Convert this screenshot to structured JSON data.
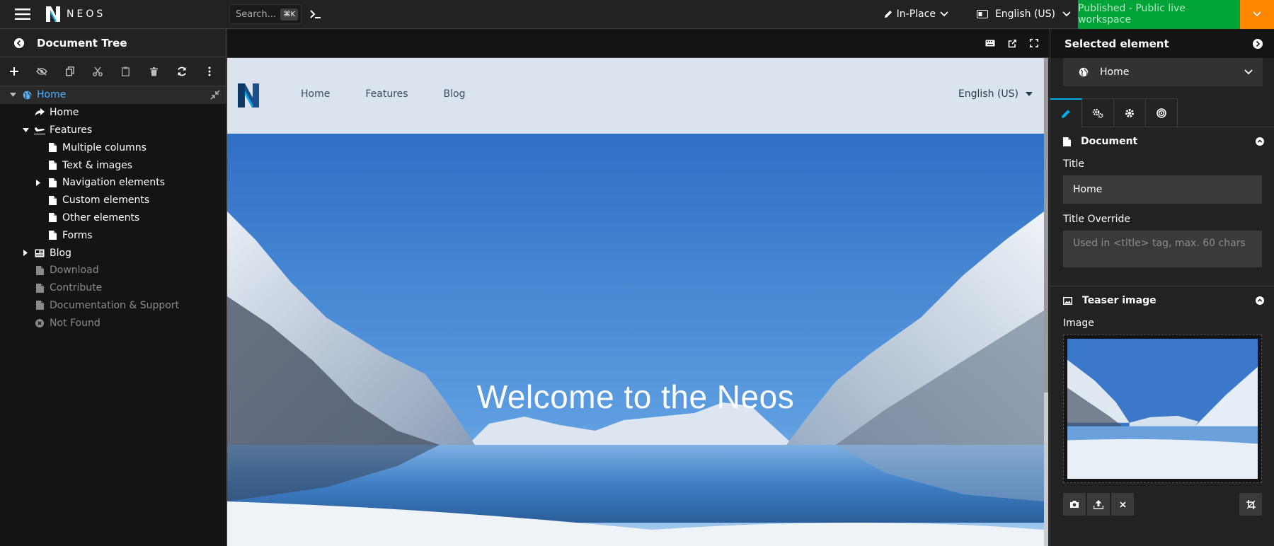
{
  "topbar": {
    "logo_text": "NEOS",
    "search_placeholder": "Search...",
    "search_shortcut": "⌘K",
    "edit_mode": "In-Place",
    "language": "English (US)",
    "publish_label": "Published - Public live workspace",
    "colors": {
      "publish": "#00a338",
      "publish_dropdown": "#ff8700"
    }
  },
  "left": {
    "title": "Document Tree",
    "tools": [
      "add-icon",
      "hide-icon",
      "copy-icon",
      "cut-icon",
      "paste-icon",
      "delete-icon",
      "refresh-icon",
      "more-icon"
    ],
    "tree": [
      {
        "label": "Home",
        "level": 0,
        "icon": "globe-icon",
        "toggle": "down",
        "active": true,
        "dim": false
      },
      {
        "label": "Home",
        "level": 1,
        "icon": "share-icon",
        "toggle": "",
        "active": false,
        "dim": false
      },
      {
        "label": "Features",
        "level": 1,
        "icon": "plane-icon",
        "toggle": "down",
        "active": false,
        "dim": false
      },
      {
        "label": "Multiple columns",
        "level": 2,
        "icon": "file-icon",
        "toggle": "",
        "active": false,
        "dim": false
      },
      {
        "label": "Text & images",
        "level": 2,
        "icon": "file-icon",
        "toggle": "",
        "active": false,
        "dim": false
      },
      {
        "label": "Navigation elements",
        "level": 2,
        "icon": "file-icon",
        "toggle": "right",
        "active": false,
        "dim": false
      },
      {
        "label": "Custom elements",
        "level": 2,
        "icon": "file-icon",
        "toggle": "",
        "active": false,
        "dim": false
      },
      {
        "label": "Other elements",
        "level": 2,
        "icon": "file-icon",
        "toggle": "",
        "active": false,
        "dim": false
      },
      {
        "label": "Forms",
        "level": 2,
        "icon": "file-icon",
        "toggle": "",
        "active": false,
        "dim": false
      },
      {
        "label": "Blog",
        "level": 1,
        "icon": "news-icon",
        "toggle": "right",
        "active": false,
        "dim": false
      },
      {
        "label": "Download",
        "level": 1,
        "icon": "file-icon",
        "toggle": "",
        "active": false,
        "dim": true
      },
      {
        "label": "Contribute",
        "level": 1,
        "icon": "file-icon",
        "toggle": "",
        "active": false,
        "dim": true
      },
      {
        "label": "Documentation & Support",
        "level": 1,
        "icon": "file-icon",
        "toggle": "",
        "active": false,
        "dim": true
      },
      {
        "label": "Not Found",
        "level": 1,
        "icon": "times-circle-icon",
        "toggle": "",
        "active": false,
        "dim": true
      }
    ]
  },
  "preview": {
    "nav": [
      "Home",
      "Features",
      "Blog"
    ],
    "language": "English (US)",
    "hero_title": "Welcome to the Neos"
  },
  "inspector": {
    "title": "Selected element",
    "selected": "Home",
    "tabs": [
      "pencil-icon",
      "cogs-icon",
      "cog-icon",
      "bullseye-icon"
    ],
    "document_section": "Document",
    "title_label": "Title",
    "title_value": "Home",
    "title_override_label": "Title Override",
    "title_override_placeholder": "Used in <title> tag, max. 60 chars",
    "teaser_section": "Teaser image",
    "image_label": "Image"
  }
}
